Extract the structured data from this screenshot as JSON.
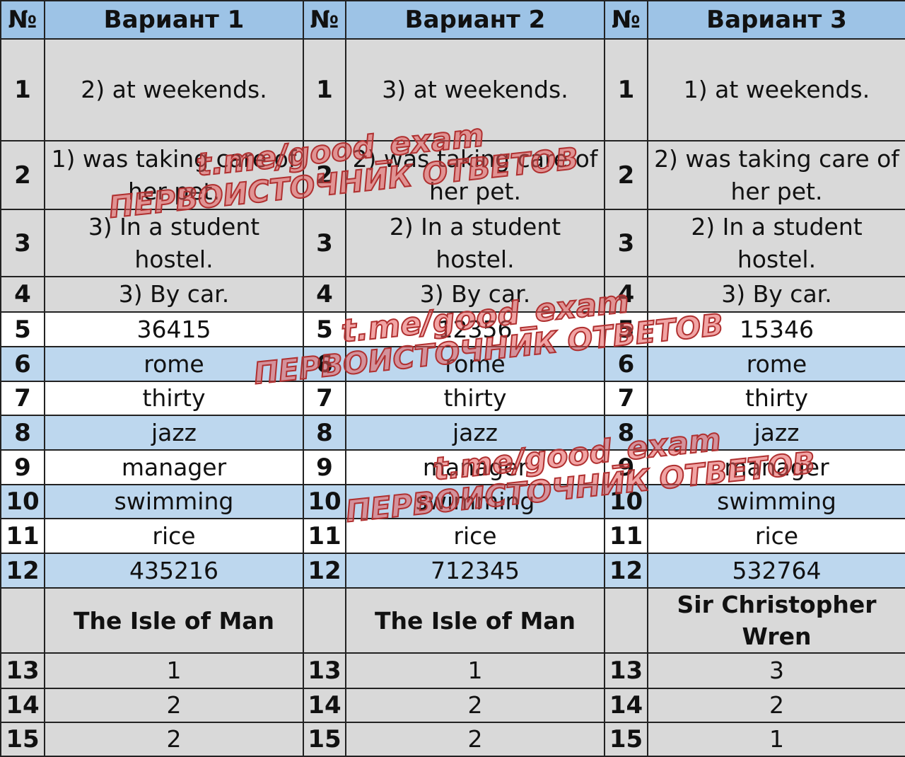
{
  "headers": {
    "num": "№",
    "variants": [
      "Вариант 1",
      "Вариант 2",
      "Вариант 3"
    ]
  },
  "rows": [
    {
      "n": "1",
      "v": [
        "2) at weekends.",
        "3) at weekends.",
        "1) at weekends."
      ]
    },
    {
      "n": "2",
      "v": [
        "1) was taking care of her pet.",
        "2) was taking care of her pet.",
        "2) was taking care of her pet."
      ]
    },
    {
      "n": "3",
      "v": [
        "3) In a student hostel.",
        "2) In a student hostel.",
        "2) In a student hostel."
      ]
    },
    {
      "n": "4",
      "v": [
        "3) By car.",
        "3) By car.",
        "3) By car."
      ]
    },
    {
      "n": "5",
      "v": [
        "36415",
        "12356",
        "15346"
      ]
    },
    {
      "n": "6",
      "v": [
        "rome",
        "rome",
        "rome"
      ]
    },
    {
      "n": "7",
      "v": [
        "thirty",
        "thirty",
        "thirty"
      ]
    },
    {
      "n": "8",
      "v": [
        "jazz",
        "jazz",
        "jazz"
      ]
    },
    {
      "n": "9",
      "v": [
        "manager",
        "manager",
        "manager"
      ]
    },
    {
      "n": "10",
      "v": [
        "swimming",
        "swimming",
        "swimming"
      ]
    },
    {
      "n": "11",
      "v": [
        "rice",
        "rice",
        "rice"
      ]
    },
    {
      "n": "12",
      "v": [
        "435216",
        "712345",
        "532764"
      ]
    }
  ],
  "section_titles": [
    "The Isle of Man",
    "The Isle of Man",
    "Sir Christopher Wren"
  ],
  "rows2": [
    {
      "n": "13",
      "v": [
        "1",
        "1",
        "3"
      ]
    },
    {
      "n": "14",
      "v": [
        "2",
        "2",
        "2"
      ]
    },
    {
      "n": "15",
      "v": [
        "2",
        "2",
        "1"
      ]
    }
  ],
  "watermark": {
    "line1": "t.me/good_exam",
    "line2": "ПЕРВОИСТОЧНИК ОТВЕТОВ"
  },
  "colors": {
    "header": "#9dc3e6",
    "gray": "#d9d9d9",
    "blue": "#bdd7ee",
    "watermark": "#e05a5a"
  }
}
